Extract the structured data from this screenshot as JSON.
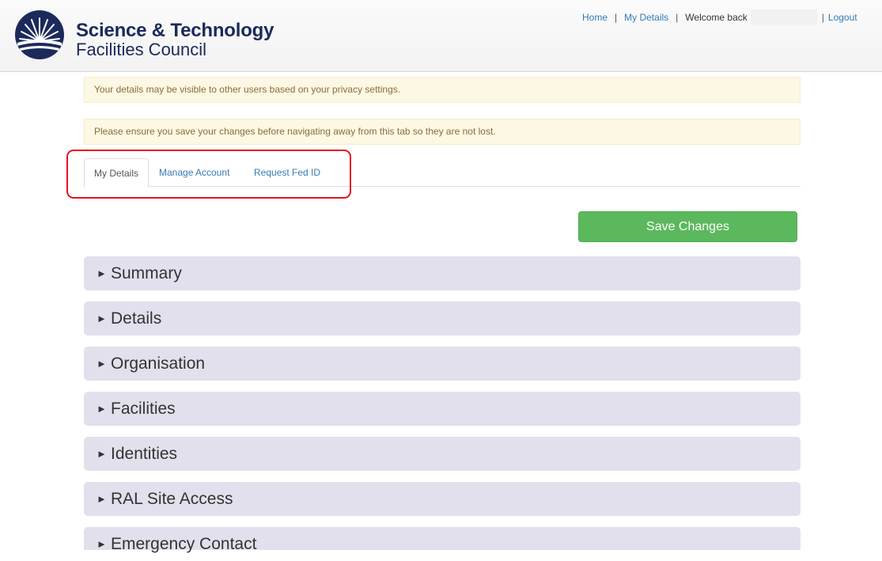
{
  "header": {
    "logo_line1": "Science & Technology",
    "logo_line2": "Facilities Council",
    "nav": {
      "home": "Home",
      "my_details": "My Details",
      "welcome": "Welcome back",
      "logout": "Logout",
      "separator": "|"
    }
  },
  "alerts": {
    "privacy": "Your details may be visible to other users based on your privacy settings.",
    "save_reminder": "Please ensure you save your changes before navigating away from this tab so they are not lost."
  },
  "tabs": {
    "my_details": "My Details",
    "manage_account": "Manage Account",
    "request_fed_id": "Request Fed ID"
  },
  "save_button": "Save Changes",
  "sections": {
    "arrow": "►",
    "summary": "Summary",
    "details": "Details",
    "organisation": "Organisation",
    "facilities": "Facilities",
    "identities": "Identities",
    "ral_site_access": "RAL Site Access",
    "emergency_contact": "Emergency Contact"
  },
  "colors": {
    "accent_link": "#337ab7",
    "save_green": "#5cb85c",
    "alert_bg": "#fcf8e3",
    "section_bg": "#e2e0ec",
    "highlight_red": "#e4131f",
    "brand_navy": "#1b2a5b"
  }
}
